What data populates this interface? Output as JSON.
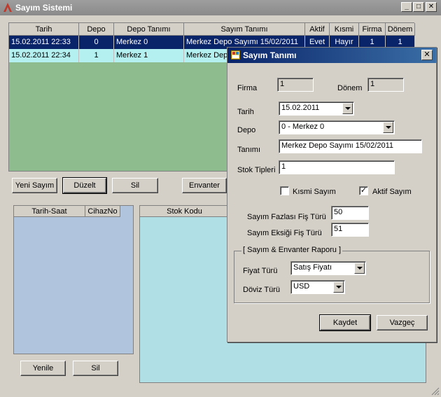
{
  "window": {
    "title": "Sayım Sistemi",
    "min": "_",
    "max": "□",
    "close": "✕"
  },
  "grid": {
    "columns": [
      "Tarih",
      "Depo",
      "Depo Tanımı",
      "Sayım Tanımı",
      "Aktif",
      "Kısmi",
      "Firma",
      "Dönem"
    ],
    "rows": [
      [
        "15.02.2011 22:33",
        "0",
        "Merkez 0",
        "Merkez Depo Sayımı 15/02/2011",
        "Evet",
        "Hayır",
        "1",
        "1"
      ],
      [
        "15.02.2011 22:34",
        "1",
        "Merkez 1",
        "Merkez Depo",
        "",
        "",
        "",
        ""
      ]
    ]
  },
  "buttons": {
    "yeni": "Yeni Sayım",
    "duzelt": "Düzelt",
    "sil": "Sil",
    "envanter": "Envanter",
    "yenile": "Yenile",
    "sil2": "Sil"
  },
  "left_panel": {
    "col1": "Tarih-Saat",
    "col2": "CihazNo"
  },
  "right_panel": {
    "col1": "Stok Kodu"
  },
  "dialog": {
    "title": "Sayım Tanımı",
    "firma_label": "Firma",
    "firma_value": "1",
    "donem_label": "Dönem",
    "donem_value": "1",
    "tarih_label": "Tarih",
    "tarih_value": "15.02.2011",
    "depo_label": "Depo",
    "depo_value": "0 - Merkez 0",
    "tanim_label": "Tanımı",
    "tanim_value": "Merkez Depo Sayımı 15/02/2011",
    "stok_label": "Stok Tipleri",
    "stok_value": "1",
    "kismi_label": "Kısmi Sayım",
    "kismi_checked": false,
    "aktif_label": "Aktif Sayım",
    "aktif_checked": true,
    "fazla_label": "Sayım Fazlası Fiş Türü",
    "fazla_value": "50",
    "eksik_label": "Sayım Eksiği Fiş Türü",
    "eksik_value": "51",
    "group_title": "[ Sayım & Envanter Raporu ]",
    "fiyat_label": "Fiyat Türü",
    "fiyat_value": "Satış Fiyatı",
    "doviz_label": "Döviz Türü",
    "doviz_value": "USD",
    "kaydet": "Kaydet",
    "vazgec": "Vazgeç"
  },
  "colors": {
    "grid_bg": "#8fbc8f",
    "selected_row": "#0a246a",
    "alt_row": "#b4f0f0",
    "left_panel": "#b0c4de",
    "right_panel": "#b0e0e6",
    "dialog_title": "#0a246a"
  }
}
